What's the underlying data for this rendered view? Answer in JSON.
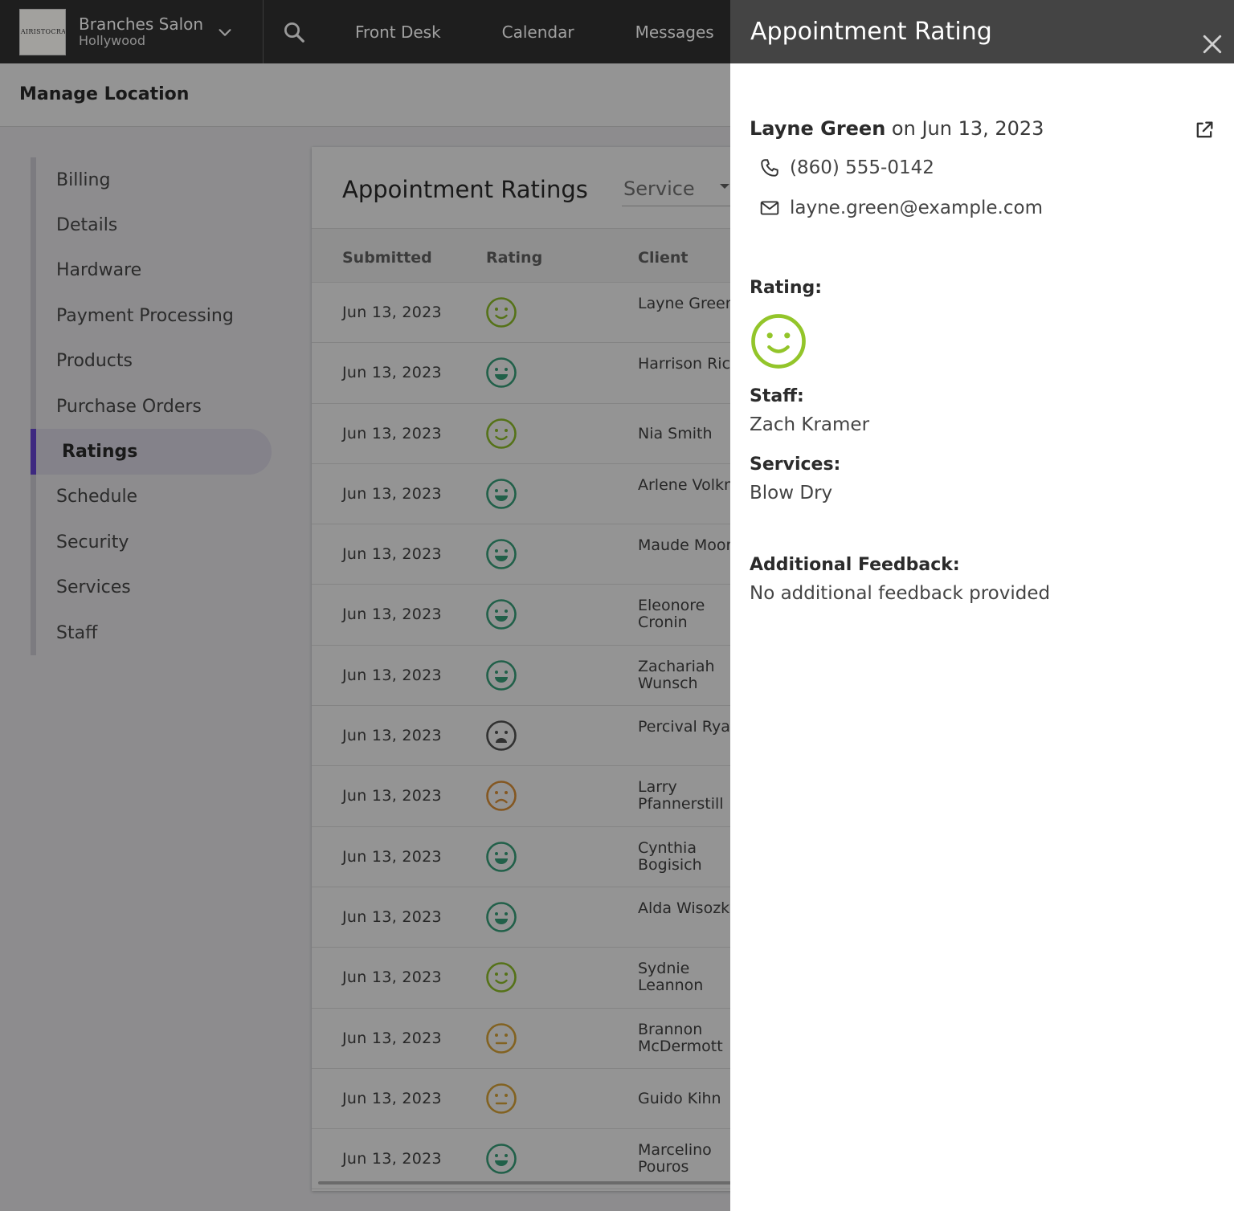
{
  "topbar": {
    "brand_name": "Branches Salon",
    "brand_location": "Hollywood",
    "logo_text": "HAIRISTOCRAT",
    "nav": [
      "Front Desk",
      "Calendar",
      "Messages"
    ]
  },
  "subheader": {
    "title": "Manage Location"
  },
  "sidebar": {
    "items": [
      "Billing",
      "Details",
      "Hardware",
      "Payment Processing",
      "Products",
      "Purchase Orders",
      "Ratings",
      "Schedule",
      "Security",
      "Services",
      "Staff"
    ],
    "active": "Ratings"
  },
  "table": {
    "title": "Appointment Ratings",
    "filter_value": "Service",
    "columns": [
      "Submitted",
      "Rating",
      "Client"
    ],
    "rows": [
      {
        "submitted": "Jun 13, 2023",
        "rating": "smile",
        "client": "Layne Green"
      },
      {
        "submitted": "Jun 13, 2023",
        "rating": "grin",
        "client": "Harrison Rice"
      },
      {
        "submitted": "Jun 13, 2023",
        "rating": "smile",
        "client": "Nia Smith"
      },
      {
        "submitted": "Jun 13, 2023",
        "rating": "grin",
        "client": "Arlene Volkman"
      },
      {
        "submitted": "Jun 13, 2023",
        "rating": "grin",
        "client": "Maude Moore"
      },
      {
        "submitted": "Jun 13, 2023",
        "rating": "grin",
        "client": "Eleonore Cronin"
      },
      {
        "submitted": "Jun 13, 2023",
        "rating": "grin",
        "client": "Zachariah Wunsch"
      },
      {
        "submitted": "Jun 13, 2023",
        "rating": "awful",
        "client": "Percival Ryan"
      },
      {
        "submitted": "Jun 13, 2023",
        "rating": "frown",
        "client": "Larry Pfannerstill"
      },
      {
        "submitted": "Jun 13, 2023",
        "rating": "grin",
        "client": "Cynthia Bogisich"
      },
      {
        "submitted": "Jun 13, 2023",
        "rating": "grin",
        "client": "Alda Wisozk"
      },
      {
        "submitted": "Jun 13, 2023",
        "rating": "smile",
        "client": "Sydnie Leannon"
      },
      {
        "submitted": "Jun 13, 2023",
        "rating": "neutral",
        "client": "Brannon McDermott"
      },
      {
        "submitted": "Jun 13, 2023",
        "rating": "neutral",
        "client": "Guido Kihn"
      },
      {
        "submitted": "Jun 13, 2023",
        "rating": "grin",
        "client": "Marcelino Pouros"
      }
    ]
  },
  "rating_colors": {
    "grin": "#3aa57f",
    "smile": "#93c52a",
    "neutral": "#e0a93a",
    "frown": "#e4963a",
    "awful": "#555555"
  },
  "drawer": {
    "title": "Appointment Rating",
    "client_name": "Layne Green",
    "date_text": " on Jun 13, 2023",
    "phone": "(860) 555-0142",
    "email": "layne.green@example.com",
    "rating_label": "Rating:",
    "rating": "smile",
    "staff_label": "Staff:",
    "staff": "Zach Kramer",
    "services_label": "Services:",
    "services": "Blow Dry",
    "feedback_label": "Additional Feedback:",
    "feedback": "No additional feedback provided"
  }
}
